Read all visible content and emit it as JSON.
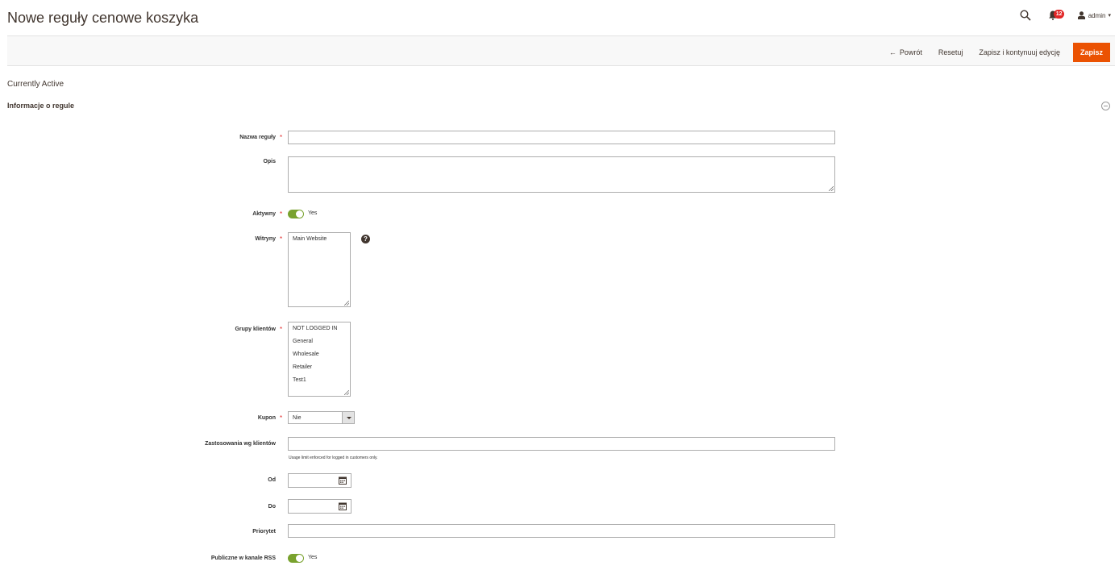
{
  "header": {
    "title": "Nowe reguły cenowe koszyka",
    "notification_count": "12",
    "user": "admin"
  },
  "toolbar": {
    "back_label": "Powrót",
    "reset_label": "Resetuj",
    "save_continue_label": "Zapisz i kontynuuj edycję",
    "save_label": "Zapisz"
  },
  "status": "Currently Active",
  "section": {
    "title": "Informacje o regule"
  },
  "form": {
    "rule_name": {
      "label": "Nazwa reguły",
      "value": ""
    },
    "description": {
      "label": "Opis",
      "value": ""
    },
    "active": {
      "label": "Aktywny",
      "toggle_text": "Yes",
      "checked": true
    },
    "websites": {
      "label": "Witryny",
      "options": [
        "Main Website"
      ]
    },
    "customer_groups": {
      "label": "Grupy klientów",
      "options": [
        "NOT LOGGED IN",
        "General",
        "Wholesale",
        "Retailer",
        "Test1"
      ]
    },
    "coupon": {
      "label": "Kupon",
      "value": "Nie"
    },
    "uses_per_customer": {
      "label": "Zastosowania wg klientów",
      "value": "",
      "note": "Usage limit enforced for logged in customers only."
    },
    "from": {
      "label": "Od",
      "value": ""
    },
    "to": {
      "label": "Do",
      "value": ""
    },
    "priority": {
      "label": "Priorytet",
      "value": ""
    },
    "rss": {
      "label": "Publiczne w kanale RSS",
      "toggle_text": "Yes",
      "checked": true
    }
  },
  "colors": {
    "accent": "#eb5202",
    "toggle_on": "#79a22e",
    "required": "#e22626"
  }
}
